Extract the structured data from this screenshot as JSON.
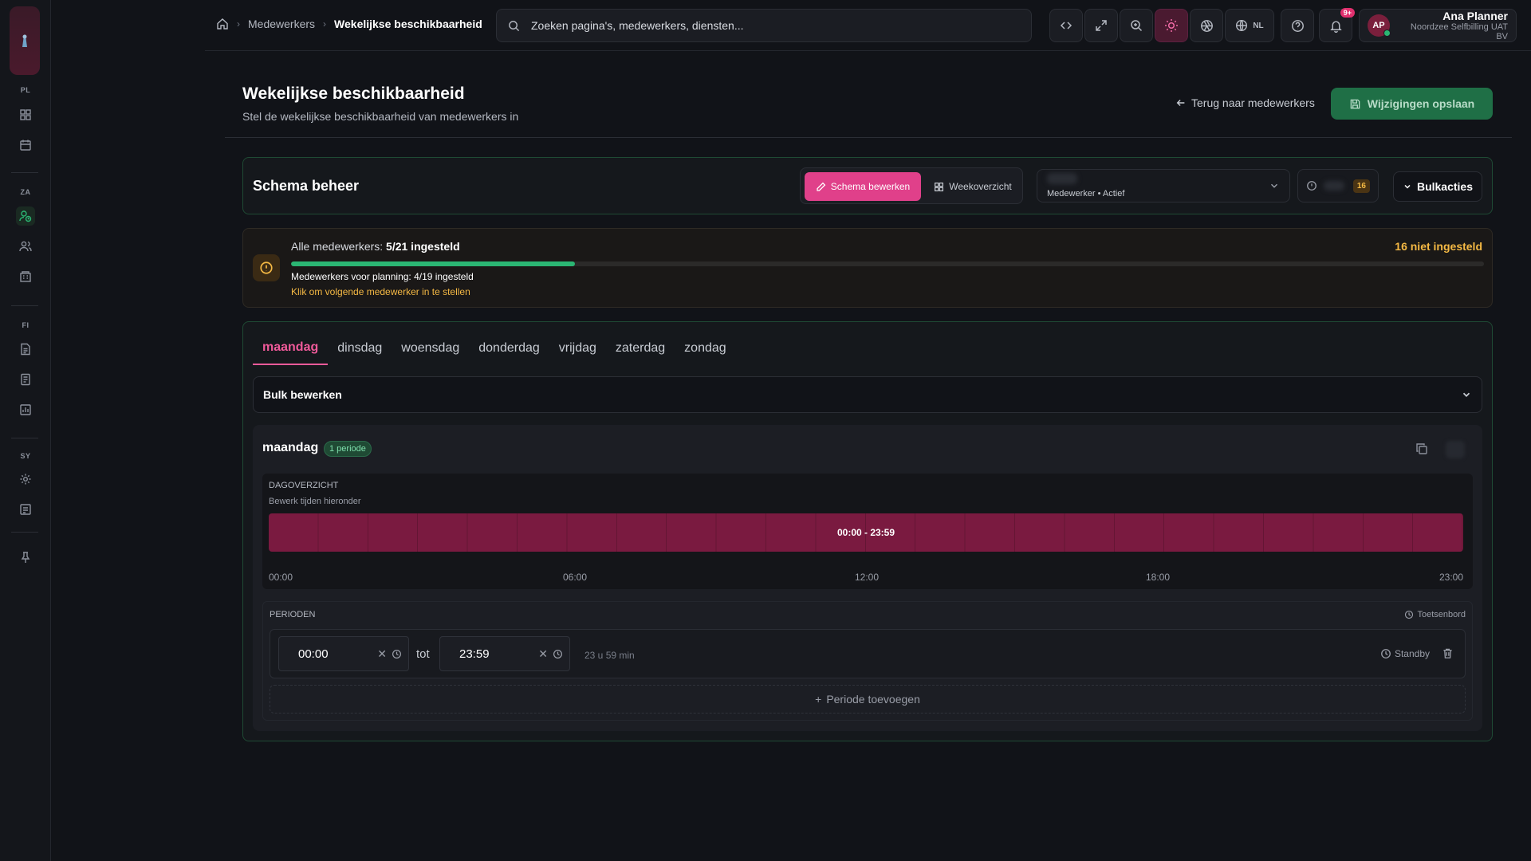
{
  "rail": {
    "sections": [
      "PL",
      "ZA",
      "FI",
      "SY"
    ]
  },
  "topbar": {
    "breadcrumb": [
      "Medewerkers",
      "Wekelijkse beschikbaarheid"
    ],
    "search_placeholder": "Zoeken pagina's, medewerkers, diensten...",
    "lang": "NL",
    "notif_badge": "9+",
    "user": {
      "initials": "AP",
      "name": "Ana Planner",
      "org": "Noordzee Selfbilling UAT BV"
    }
  },
  "page": {
    "title": "Wekelijkse beschikbaarheid",
    "subtitle": "Stel de wekelijkse beschikbaarheid van medewerkers in",
    "back_label": "Terug naar medewerkers",
    "save_label": "Wijzigingen opslaan"
  },
  "schema": {
    "title": "Schema beheer",
    "mode_edit": "Schema bewerken",
    "mode_week": "Weekoverzicht",
    "employee_sub": "Medewerker • Actief",
    "status_count": "16",
    "bulk_label": "Bulkacties"
  },
  "progress": {
    "label": "Alle medewerkers:",
    "value": "5/21 ingesteld",
    "not_set": "16 niet ingesteld",
    "fraction": 0.238,
    "sub": "Medewerkers voor planning: 4/19 ingesteld",
    "link": "Klik om volgende medewerker in te stellen"
  },
  "days": {
    "tabs": [
      "maandag",
      "dinsdag",
      "woensdag",
      "donderdag",
      "vrijdag",
      "zaterdag",
      "zondag"
    ],
    "active": "maandag",
    "bulk_edit": "Bulk bewerken",
    "day_title": "maandag",
    "period_badge": "1 periode",
    "overview_title": "Dagoverzicht",
    "overview_sub": "Bewerk tijden hieronder",
    "block_label": "00:00 - 23:59",
    "ticks": [
      "00:00",
      "06:00",
      "12:00",
      "18:00",
      "23:00"
    ],
    "periods_title": "Perioden",
    "keyboard": "Toetsenbord",
    "period": {
      "from": "00:00",
      "to": "23:59",
      "sep": "tot",
      "duration": "23 u 59 min",
      "type": "Standby"
    },
    "add_period": "Periode toevoegen"
  }
}
